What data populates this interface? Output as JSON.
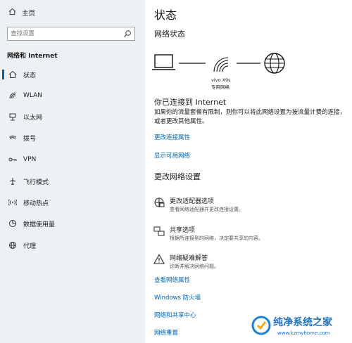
{
  "sidebar": {
    "home_label": "主页",
    "search_placeholder": "查找设置",
    "section_title": "网络和 Internet",
    "items": [
      {
        "label": "状态",
        "icon": "home-network-icon"
      },
      {
        "label": "WLAN",
        "icon": "wifi-icon"
      },
      {
        "label": "以太网",
        "icon": "ethernet-icon"
      },
      {
        "label": "拨号",
        "icon": "dialup-icon"
      },
      {
        "label": "VPN",
        "icon": "vpn-icon"
      },
      {
        "label": "飞行模式",
        "icon": "airplane-icon"
      },
      {
        "label": "移动热点",
        "icon": "hotspot-icon"
      },
      {
        "label": "数据使用量",
        "icon": "data-usage-icon"
      },
      {
        "label": "代理",
        "icon": "globe-icon"
      }
    ]
  },
  "main": {
    "title": "状态",
    "network_status_heading": "网络状态",
    "network_name": "vivo X9s",
    "network_type": "专用网络",
    "connected_title": "你已连接到 Internet",
    "connected_desc": "如果你的流量套餐有限制，则你可以将此网络设置为按流量计费的连接，或者更改其他属性。",
    "link_change_props": "更改连接属性",
    "link_show_networks": "显示可用网络",
    "change_settings_heading": "更改网络设置",
    "options": [
      {
        "title": "更改适配器选项",
        "desc": "查看网络适配器并更改连接设置。",
        "icon": "adapter-icon"
      },
      {
        "title": "共享选项",
        "desc": "根据所连接到的网络，决定要共享的内容。",
        "icon": "sharing-icon"
      },
      {
        "title": "网络疑难解答",
        "desc": "诊断并解决网络问题。",
        "icon": "warning-icon"
      }
    ],
    "bottom_links": [
      "查看网络属性",
      "Windows 防火墙",
      "网络和共享中心",
      "网络重置"
    ]
  },
  "watermark": {
    "title": "纯净系统之家",
    "url": "www.kzmyhome.com"
  },
  "colors": {
    "accent": "#0063b1",
    "sidebar_bg": "#eef1f4"
  }
}
